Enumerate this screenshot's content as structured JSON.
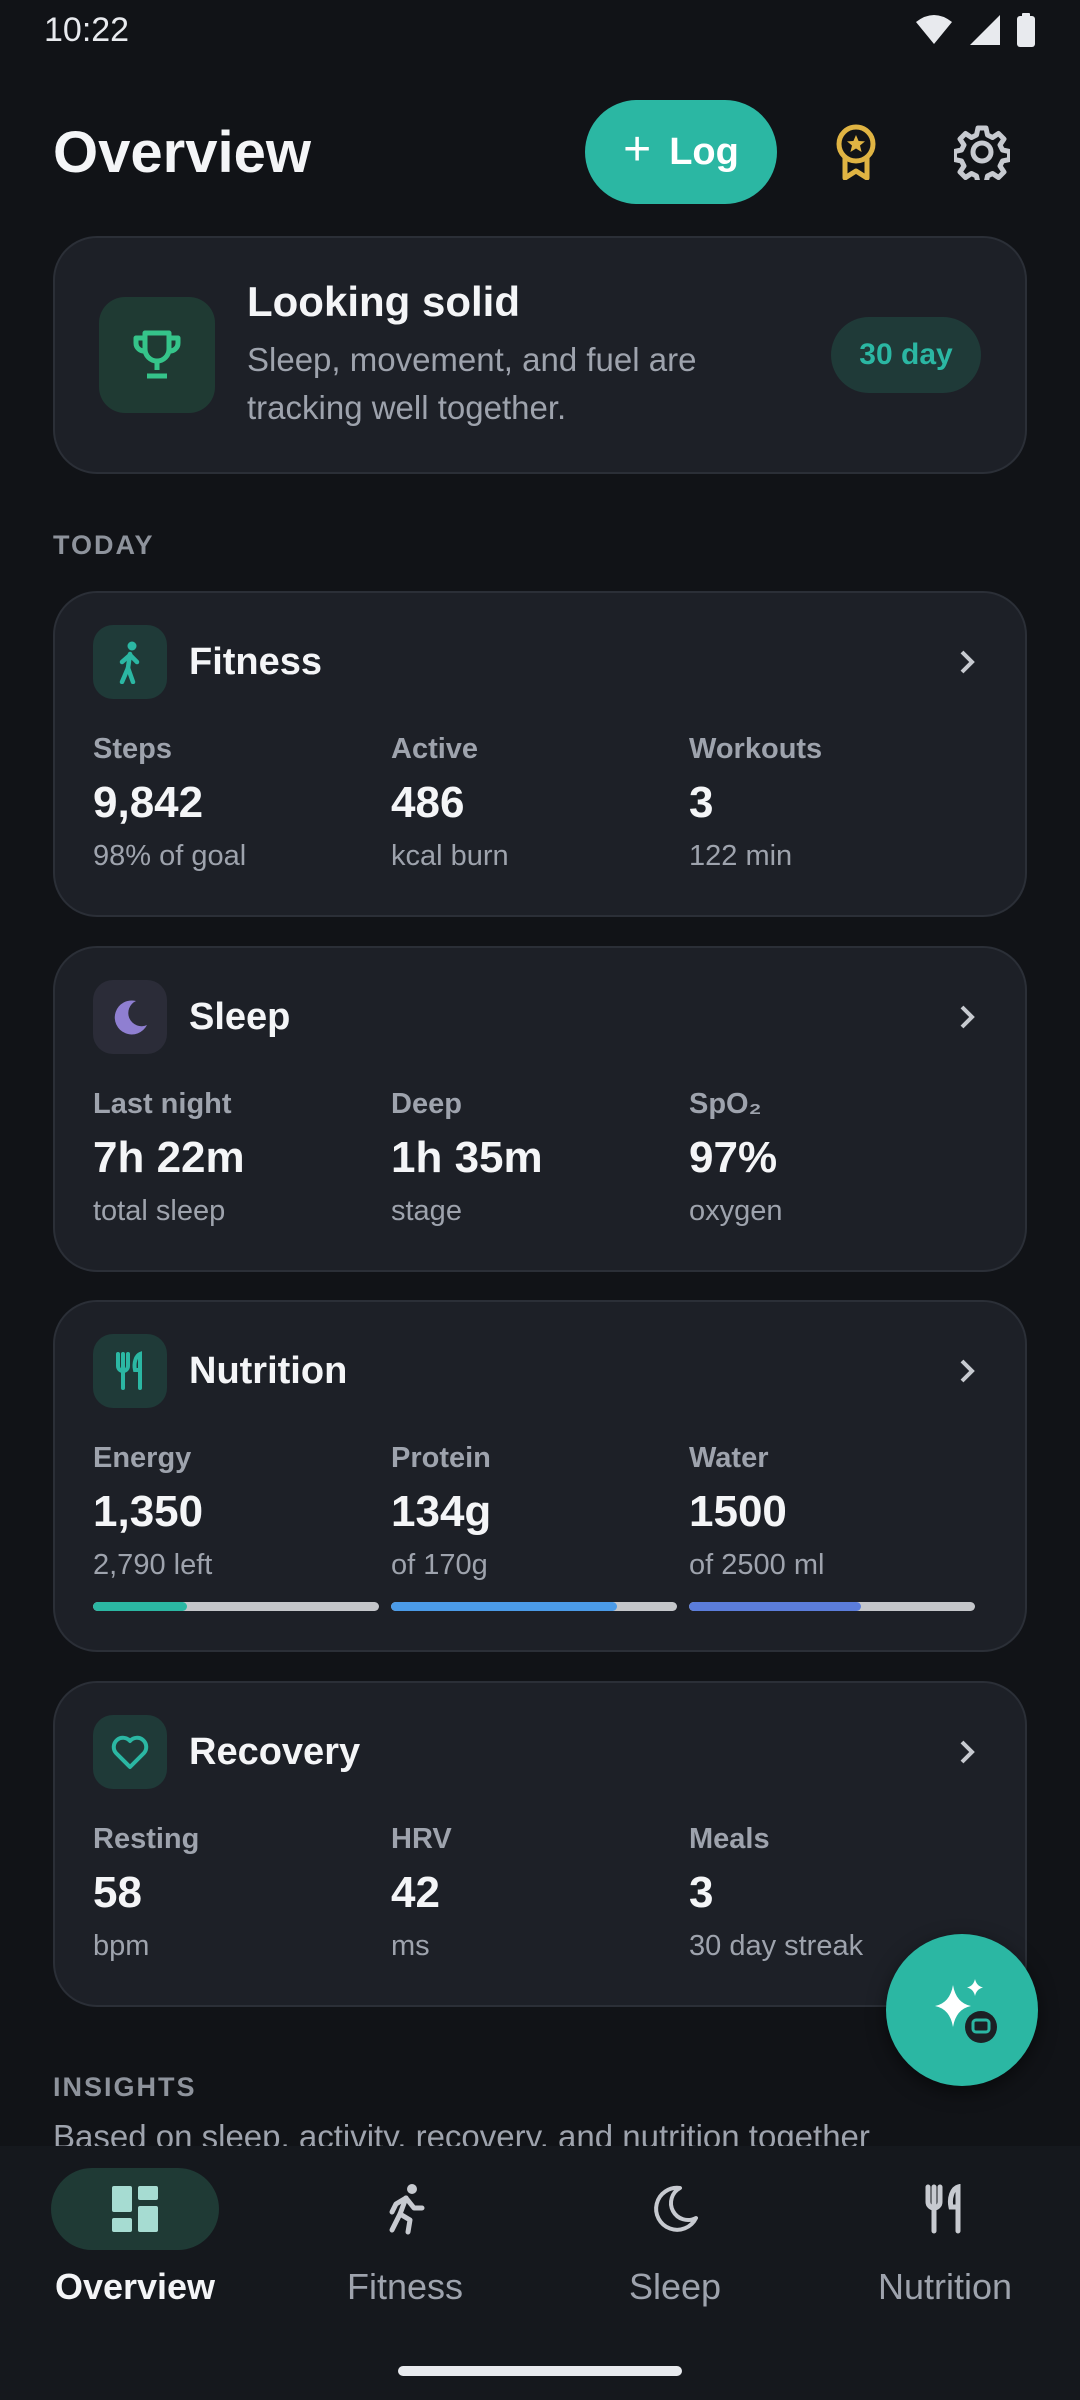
{
  "status_bar": {
    "time": "10:22"
  },
  "header": {
    "title": "Overview",
    "log_label": "Log",
    "log_icon": "+"
  },
  "summary": {
    "title": "Looking solid",
    "subtitle": "Sleep, movement, and fuel are tracking well together.",
    "badge": "30 day"
  },
  "sections": {
    "today": "TODAY",
    "insights": "INSIGHTS"
  },
  "cards": [
    {
      "title": "Fitness",
      "icon": "walking-icon",
      "stats": [
        {
          "label": "Steps",
          "value": "9,842",
          "sub": "98% of goal"
        },
        {
          "label": "Active",
          "value": "486",
          "sub": "kcal burn"
        },
        {
          "label": "Workouts",
          "value": "3",
          "sub": "122 min"
        }
      ]
    },
    {
      "title": "Sleep",
      "icon": "moon-icon",
      "stats": [
        {
          "label": "Last night",
          "value": "7h 22m",
          "sub": "total sleep"
        },
        {
          "label": "Deep",
          "value": "1h 35m",
          "sub": "stage"
        },
        {
          "label": "SpO₂",
          "value": "97%",
          "sub": "oxygen"
        }
      ]
    },
    {
      "title": "Nutrition",
      "icon": "fork-knife-icon",
      "stats": [
        {
          "label": "Energy",
          "value": "1,350",
          "sub": "2,790 left",
          "progress": 0.33
        },
        {
          "label": "Protein",
          "value": "134g",
          "sub": "of 170g",
          "progress": 0.79
        },
        {
          "label": "Water",
          "value": "1500",
          "sub": "of 2500 ml",
          "progress": 0.6
        }
      ]
    },
    {
      "title": "Recovery",
      "icon": "heart-icon",
      "stats": [
        {
          "label": "Resting",
          "value": "58",
          "sub": "bpm"
        },
        {
          "label": "HRV",
          "value": "42",
          "sub": "ms"
        },
        {
          "label": "Meals",
          "value": "3",
          "sub": "30 day streak"
        }
      ]
    }
  ],
  "insights": {
    "text": "Based on sleep, activity, recovery, and nutrition together"
  },
  "nav": [
    {
      "label": "Overview",
      "icon": "dashboard-icon",
      "active": true
    },
    {
      "label": "Fitness",
      "icon": "running-icon",
      "active": false
    },
    {
      "label": "Sleep",
      "icon": "moon-icon",
      "active": false
    },
    {
      "label": "Nutrition",
      "icon": "fork-knife-icon",
      "active": false
    }
  ],
  "colors": {
    "accent": "#2bb7a3",
    "background": "#111317",
    "card": "#1d2027",
    "sleep_accent": "#8f7fd1",
    "energy_bar": "#2bb7a3",
    "protein_bar": "#4b9be8",
    "water_bar": "#5b7ddb",
    "award": "#e0b443"
  }
}
